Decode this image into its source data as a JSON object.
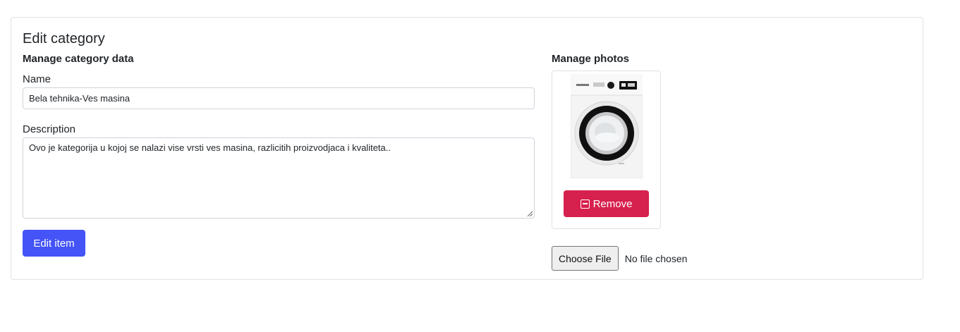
{
  "card": {
    "title": "Edit category"
  },
  "category_form": {
    "section_title": "Manage category data",
    "name_label": "Name",
    "name_value": "Bela tehnika-Ves masina",
    "description_label": "Description",
    "description_value": "Ovo je kategorija u kojoj se nalazi vise vrsti ves masina, razlicitih proizvodjaca i kvaliteta..",
    "submit_label": "Edit item"
  },
  "photos": {
    "section_title": "Manage photos",
    "items": [
      {
        "image": "washing-machine",
        "remove_label": "Remove",
        "remove_icon": "minus-square-icon"
      }
    ],
    "file_input": {
      "button_label": "Choose File",
      "status": "No file chosen"
    }
  },
  "colors": {
    "primary": "#4454f7",
    "danger": "#d6204d",
    "border": "#dfe2e6"
  }
}
